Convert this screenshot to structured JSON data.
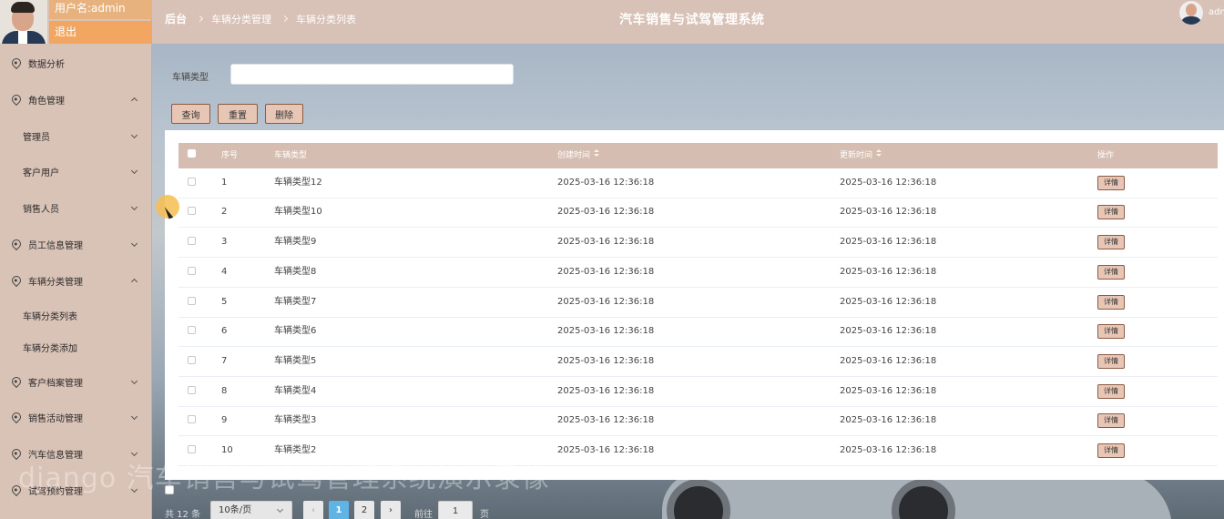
{
  "user": {
    "username": "用户名:admin",
    "logout": "退出",
    "top_user": "adm"
  },
  "header": {
    "breadcrumb": [
      "后台",
      "车辆分类管理",
      "车辆分类列表"
    ],
    "title": "汽车销售与试驾管理系统"
  },
  "sidebar": {
    "items": [
      {
        "label": "数据分析",
        "icon": "location-pin-icon"
      },
      {
        "label": "角色管理",
        "icon": "location-pin-icon",
        "expanded": true
      },
      {
        "label": "管理员"
      },
      {
        "label": "客户用户"
      },
      {
        "label": "销售人员"
      },
      {
        "label": "员工信息管理",
        "icon": "location-pin-icon"
      },
      {
        "label": "车辆分类管理",
        "icon": "location-pin-icon",
        "expanded": true
      },
      {
        "label": "车辆分类列表"
      },
      {
        "label": "车辆分类添加"
      },
      {
        "label": "客户档案管理",
        "icon": "location-pin-icon"
      },
      {
        "label": "销售活动管理",
        "icon": "location-pin-icon"
      },
      {
        "label": "汽车信息管理",
        "icon": "location-pin-icon"
      },
      {
        "label": "试驾预约管理",
        "icon": "location-pin-icon"
      }
    ]
  },
  "search": {
    "label": "车辆类型",
    "value": ""
  },
  "buttons": {
    "query": "查询",
    "reset": "重置",
    "delete": "删除"
  },
  "table": {
    "columns": [
      "序号",
      "车辆类型",
      "创建时间",
      "更新时间",
      "操作"
    ],
    "detail_label": "详情",
    "rows": [
      {
        "no": "1",
        "type": "车辆类型12",
        "created": "2025-03-16 12:36:18",
        "updated": "2025-03-16 12:36:18"
      },
      {
        "no": "2",
        "type": "车辆类型10",
        "created": "2025-03-16 12:36:18",
        "updated": "2025-03-16 12:36:18"
      },
      {
        "no": "3",
        "type": "车辆类型9",
        "created": "2025-03-16 12:36:18",
        "updated": "2025-03-16 12:36:18"
      },
      {
        "no": "4",
        "type": "车辆类型8",
        "created": "2025-03-16 12:36:18",
        "updated": "2025-03-16 12:36:18"
      },
      {
        "no": "5",
        "type": "车辆类型7",
        "created": "2025-03-16 12:36:18",
        "updated": "2025-03-16 12:36:18"
      },
      {
        "no": "6",
        "type": "车辆类型6",
        "created": "2025-03-16 12:36:18",
        "updated": "2025-03-16 12:36:18"
      },
      {
        "no": "7",
        "type": "车辆类型5",
        "created": "2025-03-16 12:36:18",
        "updated": "2025-03-16 12:36:18"
      },
      {
        "no": "8",
        "type": "车辆类型4",
        "created": "2025-03-16 12:36:18",
        "updated": "2025-03-16 12:36:18"
      },
      {
        "no": "9",
        "type": "车辆类型3",
        "created": "2025-03-16 12:36:18",
        "updated": "2025-03-16 12:36:18"
      },
      {
        "no": "10",
        "type": "车辆类型2",
        "created": "2025-03-16 12:36:18",
        "updated": "2025-03-16 12:36:18"
      }
    ]
  },
  "pagination": {
    "total": "共 12 条",
    "page_size": "10条/页",
    "pages": [
      "1",
      "2"
    ],
    "current": "1",
    "goto_label": "前往",
    "goto_value": "1",
    "page_suffix": "页"
  },
  "watermark": "django 汽车销售与试驾管理系统演示录像"
}
